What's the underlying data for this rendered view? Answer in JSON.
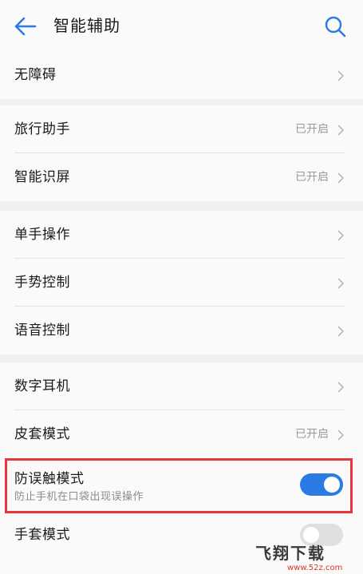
{
  "header": {
    "title": "智能辅助",
    "back_icon": "arrow-left-icon",
    "search_icon": "search-icon",
    "accent_color": "#2a7be4"
  },
  "groups": [
    {
      "items": [
        {
          "label": "无障碍",
          "status": ""
        }
      ]
    },
    {
      "items": [
        {
          "label": "旅行助手",
          "status": "已开启"
        },
        {
          "label": "智能识屏",
          "status": "已开启"
        }
      ]
    },
    {
      "items": [
        {
          "label": "单手操作",
          "status": ""
        },
        {
          "label": "手势控制",
          "status": ""
        },
        {
          "label": "语音控制",
          "status": ""
        }
      ]
    },
    {
      "items": [
        {
          "label": "数字耳机",
          "status": ""
        },
        {
          "label": "皮套模式",
          "status": "已开启"
        },
        {
          "label": "防误触模式",
          "sublabel": "防止手机在口袋出现误操作",
          "toggle": true
        },
        {
          "label": "手套模式",
          "toggle": false
        }
      ]
    }
  ],
  "highlight_color": "#e8363b",
  "watermark": {
    "text": "飞翔下载",
    "url": "www.52z.com"
  }
}
